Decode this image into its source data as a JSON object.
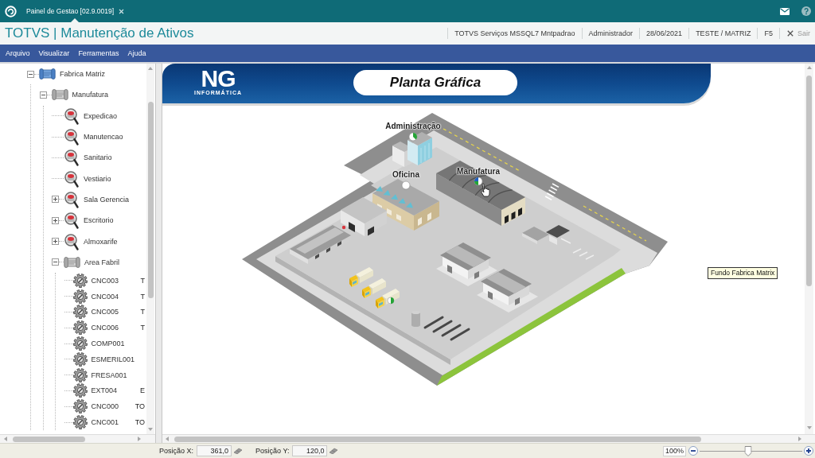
{
  "window": {
    "tab": {
      "label": "Painel de Gestao [02.9.0019]"
    }
  },
  "header": {
    "title": "TOTVS | Manutenção de Ativos",
    "info": [
      "TOTVS Serviços MSSQL7 Mntpadrao",
      "Administrador",
      "28/06/2021",
      "TESTE / MATRIZ",
      "F5"
    ],
    "exit_label": "Sair"
  },
  "menu": [
    "Arquivo",
    "Visualizar",
    "Ferramentas",
    "Ajuda"
  ],
  "tree": [
    {
      "label": "Fabrica Matriz",
      "kind": "site",
      "expanded": true,
      "children": [
        {
          "label": "Manufatura",
          "kind": "area",
          "expanded": true,
          "children": [
            {
              "label": "Expedicao",
              "kind": "sector"
            },
            {
              "label": "Manutencao",
              "kind": "sector"
            },
            {
              "label": "Sanitario",
              "kind": "sector"
            },
            {
              "label": "Vestiario",
              "kind": "sector"
            },
            {
              "label": "Sala Gerencia",
              "kind": "sector",
              "expanded": false
            },
            {
              "label": "Escritorio",
              "kind": "sector",
              "expanded": false
            },
            {
              "label": "Almoxarife",
              "kind": "sector",
              "expanded": false
            },
            {
              "label": "Area Fabril",
              "kind": "area",
              "expanded": true,
              "children": [
                {
                  "label": "CNC003",
                  "kind": "equipment",
                  "column_2": "T"
                },
                {
                  "label": "CNC004",
                  "kind": "equipment",
                  "column_2": "T"
                },
                {
                  "label": "CNC005",
                  "kind": "equipment",
                  "column_2": "T"
                },
                {
                  "label": "CNC006",
                  "kind": "equipment",
                  "column_2": "T"
                },
                {
                  "label": "COMP001",
                  "kind": "equipment"
                },
                {
                  "label": "ESMERIL001",
                  "kind": "equipment"
                },
                {
                  "label": "FRESA001",
                  "kind": "equipment"
                },
                {
                  "label": "EXT004",
                  "kind": "equipment",
                  "column_2": "E"
                },
                {
                  "label": "CNC000",
                  "kind": "equipment",
                  "column_2": "TO"
                },
                {
                  "label": "CNC001",
                  "kind": "equipment",
                  "column_2": "TO"
                }
              ]
            }
          ]
        }
      ]
    }
  ],
  "banner": {
    "logo": "NG",
    "logo_subtitle": "INFORMÁTICA",
    "title": "Planta Gráfica"
  },
  "plant": {
    "areas": [
      {
        "label": "Administração"
      },
      {
        "label": "Oficina"
      },
      {
        "label": "Manufatura"
      }
    ],
    "tooltip": "Fundo Fabrica Matrix"
  },
  "status_bar": {
    "fields": [
      {
        "label": "Posição X:",
        "value": "361,0"
      },
      {
        "label": "Posição Y:",
        "value": "120,0"
      }
    ],
    "zoom": {
      "reading": "100%",
      "level": 0.47
    }
  }
}
